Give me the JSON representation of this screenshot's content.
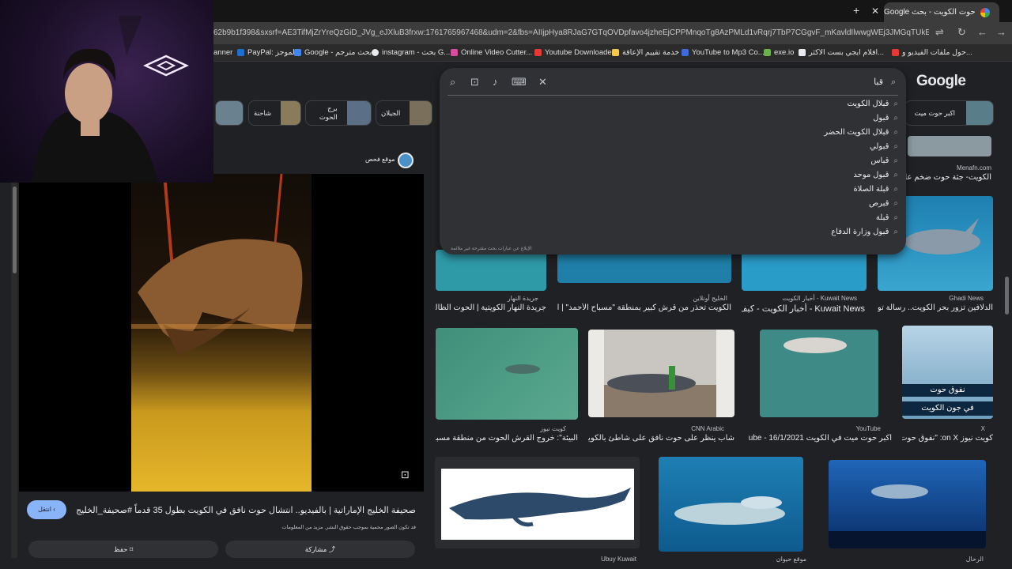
{
  "browser": {
    "tab_title": "حوت الكويت - بحث Google",
    "url": "62b9b1f398&sxsrf=AE3TifMjZrYreQzGiD_JVg_eJXluB3frxw:1761765967468&udm=2&fbs=AIIjpHya8RJaG7GTqOVDpfavo4jzheEjCPPMnqoTg8AzPMLd1vRqrj7TbP7CGgvF_mKavldIlwwgWEj3JMGqTUkE0CjMRfUfTwmUb93qlL...",
    "bookmarks": [
      {
        "label": "anner",
        "color": "#888"
      },
      {
        "label": "PayPal: الموجز",
        "color": "#1f6fd0"
      },
      {
        "label": "Google - بحث مترجم",
        "color": "#4285f4"
      },
      {
        "label": "instagram - بحث G...",
        "color": "#e8eaed"
      },
      {
        "label": "Online Video Cutter...",
        "color": "#d94b9b"
      },
      {
        "label": "Youtube Downloade...",
        "color": "#e53935"
      },
      {
        "label": "خدمة تقييم الإعاقة",
        "color": "#f2c94c"
      },
      {
        "label": "YouTube to Mp3 Co...",
        "color": "#3f6ad8"
      },
      {
        "label": "exe.io",
        "color": "#6ab04c"
      },
      {
        "label": "افلام ايجي بست الاكثر...",
        "color": "#e8eaed"
      },
      {
        "label": "حول ملفات الفيديو و...",
        "color": "#e53935"
      }
    ]
  },
  "search": {
    "logo": "Google",
    "query": "قبا",
    "suggestions": [
      "قبلال الكويت",
      "قبول",
      "قبلال الكويت الحضر",
      "قبولي",
      "قباس",
      "قبول موحد",
      "قبلة الصلاة",
      "قبرص",
      "قبلة",
      "قبول وزارة الدفاع"
    ],
    "report_text": "الإبلاغ عن عبارات بحث مقترحة غير ملائمة"
  },
  "chips": [
    {
      "label": "اكبر حوت ميت",
      "color": "#5a7d8a"
    },
    {
      "label": "الجيلان",
      "color": "#7a6f5b"
    },
    {
      "label": "برج الحوت",
      "color": "#5b6f87"
    },
    {
      "label": "شاحنة",
      "color": "#8a7b5a"
    }
  ],
  "preview": {
    "source": "موقع فحص",
    "title": "صحيفة الخليج الإماراتية | بالفيديو.. انتشال حوت نافق في الكويت بطول 35 قدماً #صحيفة_الخليج",
    "note": "قد تكون الصور محمية بموجب حقوق النشر. مزيد من المعلومات",
    "visit": "انتقل",
    "share": "مشاركة",
    "save": "حفظ"
  },
  "results": {
    "top": [
      {
        "source": "Menafn.com",
        "title": "الكويت- جثة حوت ضخم على..."
      }
    ],
    "row1": [
      {
        "source": "جريدة النهار",
        "title": "جريدة النهار الكويتية | الحوت الظالم..."
      },
      {
        "source": "الخليج أونلاين",
        "title": "الكويت تحذر من قرش كبير بمنطقة \"مسباح الأحمد\" | الخليـ..."
      },
      {
        "source": "Kuwait News - أخبار الكويت",
        "title": "Kuwait News - أخبار الكويت - كيف..."
      },
      {
        "source": "Ghadi News",
        "title": "الدلافين تزور بحر الكويت.. رسالة تو..."
      }
    ],
    "row2": [
      {
        "source": "كويت نيوز",
        "title": "البيئة\": خروج القرش الحوت من منطقة مسباح ا..."
      },
      {
        "source": "CNN Arabic",
        "title": "شاب ينظر على حوت نافق على شاطئ بالكويت -..."
      },
      {
        "source": "YouTube",
        "title": "اكبر حوت ميت في الكويت 16/1/2021 - ube"
      },
      {
        "source": "X",
        "title": "كويت نيوز on X: \"نفوق حوت..."
      }
    ],
    "row3": [
      {
        "source": "Ubuy Kuwait",
        "title": ""
      },
      {
        "source": "موقع حيوان",
        "title": ""
      },
      {
        "source": "الرحال",
        "title": ""
      }
    ],
    "overlay_caption_1": "نفوق حوت",
    "overlay_caption_2": "في جون الكويت"
  }
}
